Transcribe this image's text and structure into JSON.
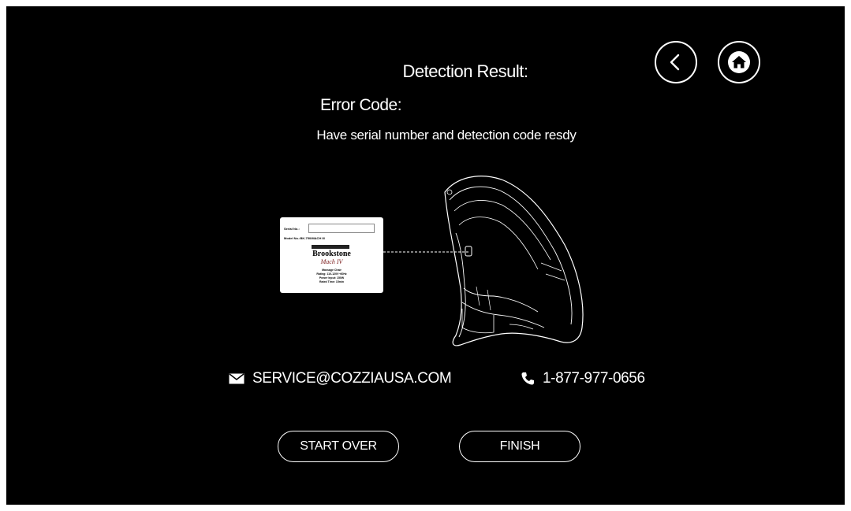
{
  "header": {
    "title": "Detection Result:",
    "error_label": "Error Code:",
    "instruction": "Have serial number and detection code resdy"
  },
  "nav": {
    "back_icon": "chevron-left-icon",
    "home_icon": "home-icon"
  },
  "label_card": {
    "serial_label": "Serial No.:",
    "model_label": "Model No.:BK-750/MACH III",
    "brand": "Brookstone",
    "sub_brand": "Mach IV",
    "spec_lines": [
      "Massage Chair",
      "Rating: 110-120V~60Hz",
      "Power Input: 150W",
      "Rated Time: 15min"
    ]
  },
  "contact": {
    "email_icon": "envelope-icon",
    "email": "SERVICE@COZZIAUSA.COM",
    "phone_icon": "phone-icon",
    "phone": "1-877-977-0656"
  },
  "actions": {
    "start_over": "START OVER",
    "finish": "FINISH"
  },
  "colors": {
    "background": "#000000",
    "foreground": "#ffffff"
  }
}
